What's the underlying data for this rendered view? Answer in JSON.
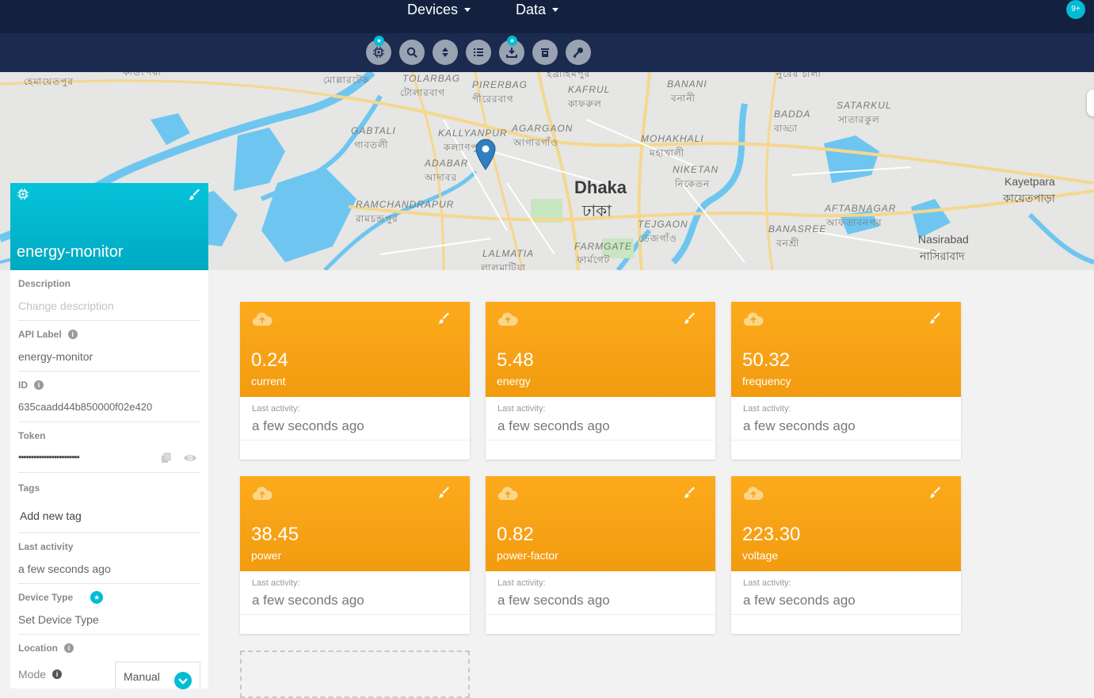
{
  "nav": {
    "devices": "Devices",
    "data": "Data",
    "notifications": "9+"
  },
  "toolbar": {
    "buttons": [
      "chip-icon",
      "search-icon",
      "sort-icon",
      "list-icon",
      "download-icon",
      "trash-icon",
      "key-icon"
    ]
  },
  "map": {
    "labels": {
      "hemayetpur": "হেমায়েতপুর",
      "top_left": "কাউন্দিয়া",
      "mollartek": "মোল্লারটেক",
      "tolarbag": "TOLARBAG",
      "tolarbag_bn": "টোলারবাগ",
      "pirerbag": "PIRERBAG",
      "pirerbag_bn": "পীরেরবাগ",
      "ibrahimpur": "ইব্রাহিমপুর",
      "kafrul": "KAFRUL",
      "kafrul_bn": "কাফরুল",
      "banani": "BANANI",
      "banani_bn": "বনানী",
      "nurer_chala": "নুরের চালা",
      "badda": "BADDA",
      "badda_bn": "বাড্ডা",
      "satarkul": "SATARKUL",
      "satarkul_bn": "সাতারকুল",
      "gabtali": "GABTALI",
      "gabtali_bn": "গাবতলী",
      "kallyanpur": "KALLYANPUR",
      "kallyanpur_bn": "কল্যাণপুর",
      "agargaon": "AGARGAON",
      "agargaon_bn": "আগারগাঁও",
      "mohakhali": "MOHAKHALI",
      "mohakhali_bn": "মহাখালী",
      "adabar": "ADABAR",
      "adabar_bn": "আদাবর",
      "niketan": "NIKETAN",
      "niketan_bn": "নিকেতন",
      "dhaka": "Dhaka",
      "dhaka_bn": "ঢাকা",
      "kayetpara": "Kayetpara",
      "kayetpara_bn": "কায়েতপাড়া",
      "ramchandrapur": "RAMCHANDRAPUR",
      "ramchandrapur_bn": "রামচন্দ্রপুর",
      "aftabnagar": "AFTABNAGAR",
      "aftabnagar_bn": "আফতাবনগর",
      "tejgaon": "TEJGAON",
      "tejgaon_bn": "তেজগাঁও",
      "banasree": "BANASREE",
      "banasree_bn": "বনশ্রী",
      "nasirabad": "Nasirabad",
      "nasirabad_bn": "নাসিরাবাদ",
      "farmgate": "FARMGATE",
      "farmgate_bn": "ফার্মগেট",
      "lalmatia": "LALMATIA",
      "lalmatia_bn": "লালমাটিয়া"
    }
  },
  "device": {
    "name": "energy-monitor",
    "description_label": "Description",
    "description_placeholder": "Change description",
    "api_label_label": "API Label",
    "api_label_value": "energy-monitor",
    "id_label": "ID",
    "id_value": "635caadd44b850000f02e420",
    "token_label": "Token",
    "token_value": "••••••••••••••••••••••••",
    "tags_label": "Tags",
    "tags_placeholder": "Add new tag",
    "last_activity_label": "Last activity",
    "last_activity_value": "a few seconds ago",
    "device_type_label": "Device Type",
    "device_type_placeholder": "Set Device Type",
    "location_label": "Location",
    "mode_label": "Mode",
    "mode_value": "Manual"
  },
  "variables": [
    {
      "value": "0.24",
      "name": "current",
      "last_activity_label": "Last activity:",
      "last_activity": "a few seconds ago"
    },
    {
      "value": "5.48",
      "name": "energy",
      "last_activity_label": "Last activity:",
      "last_activity": "a few seconds ago"
    },
    {
      "value": "50.32",
      "name": "frequency",
      "last_activity_label": "Last activity:",
      "last_activity": "a few seconds ago"
    },
    {
      "value": "38.45",
      "name": "power",
      "last_activity_label": "Last activity:",
      "last_activity": "a few seconds ago"
    },
    {
      "value": "0.82",
      "name": "power-factor",
      "last_activity_label": "Last activity:",
      "last_activity": "a few seconds ago"
    },
    {
      "value": "223.30",
      "name": "voltage",
      "last_activity_label": "Last activity:",
      "last_activity": "a few seconds ago"
    }
  ],
  "colors": {
    "topbar": "#13213f",
    "toolbar": "#1b2b4f",
    "accent": "#00bcd4",
    "variable_card": "#f7a216"
  }
}
